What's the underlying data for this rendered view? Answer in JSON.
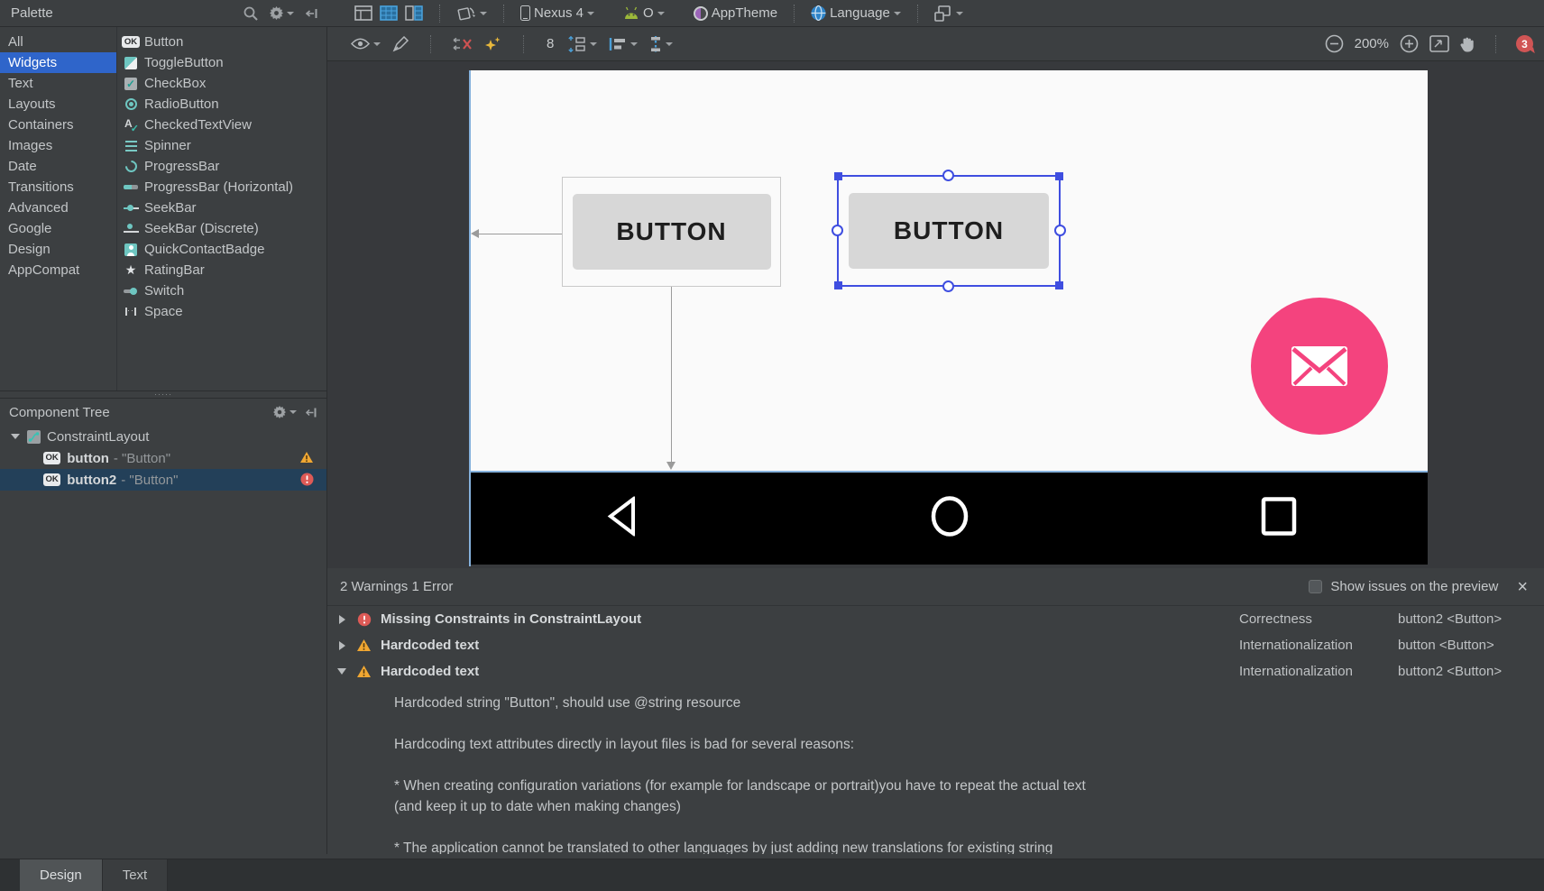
{
  "topbar": {
    "palette_title": "Palette",
    "device_label": "Nexus 4",
    "api_label": "O",
    "theme_label": "AppTheme",
    "language_label": "Language"
  },
  "design_toolbar": {
    "default_margin": "8",
    "zoom_level": "200%",
    "issues_count": "3"
  },
  "palette": {
    "categories": [
      {
        "label": "All"
      },
      {
        "label": "Widgets"
      },
      {
        "label": "Text"
      },
      {
        "label": "Layouts"
      },
      {
        "label": "Containers"
      },
      {
        "label": "Images"
      },
      {
        "label": "Date"
      },
      {
        "label": "Transitions"
      },
      {
        "label": "Advanced"
      },
      {
        "label": "Google"
      },
      {
        "label": "Design"
      },
      {
        "label": "AppCompat"
      }
    ],
    "widgets": [
      {
        "label": "Button"
      },
      {
        "label": "ToggleButton"
      },
      {
        "label": "CheckBox"
      },
      {
        "label": "RadioButton"
      },
      {
        "label": "CheckedTextView"
      },
      {
        "label": "Spinner"
      },
      {
        "label": "ProgressBar"
      },
      {
        "label": "ProgressBar (Horizontal)"
      },
      {
        "label": "SeekBar"
      },
      {
        "label": "SeekBar (Discrete)"
      },
      {
        "label": "QuickContactBadge"
      },
      {
        "label": "RatingBar"
      },
      {
        "label": "Switch"
      },
      {
        "label": "Space"
      }
    ]
  },
  "component_tree": {
    "title": "Component Tree",
    "root_label": "ConstraintLayout",
    "items": [
      {
        "label": "button",
        "suffix": "- \"Button\"",
        "status": "warning"
      },
      {
        "label": "button2",
        "suffix": "- \"Button\"",
        "status": "error"
      }
    ]
  },
  "canvas": {
    "button1_label": "BUTTON",
    "button2_label": "BUTTON"
  },
  "issues": {
    "summary": "2 Warnings 1 Error",
    "preview_toggle_label": "Show issues on the preview",
    "rows": [
      {
        "title": "Missing Constraints in ConstraintLayout",
        "category": "Correctness",
        "item": "button2 <Button>"
      },
      {
        "title": "Hardcoded text",
        "category": "Internationalization",
        "item": "button <Button>"
      },
      {
        "title": "Hardcoded text",
        "category": "Internationalization",
        "item": "button2 <Button>"
      }
    ],
    "detail": "Hardcoded string \"Button\", should use @string resource\n\nHardcoding text attributes directly in layout files is bad for several reasons:\n\n* When creating configuration variations (for example for landscape or portrait)you have to repeat the actual text\n(and keep it up to date when making changes)\n\n* The application cannot be translated to other languages by just adding new translations for existing string"
  },
  "footer": {
    "tabs": [
      {
        "label": "Design"
      },
      {
        "label": "Text"
      }
    ]
  }
}
